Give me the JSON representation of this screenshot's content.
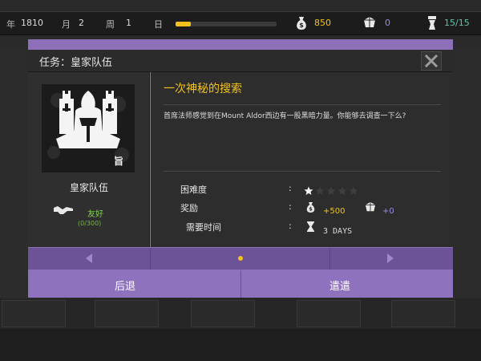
{
  "topbar": {
    "year_label": "年",
    "year_value": "1810",
    "month_label": "月",
    "month_value": "2",
    "week_label": "周",
    "week_value": "1",
    "day_label": "日",
    "day_progress": 0.15,
    "gold_value": "850",
    "gem_value": "0",
    "capacity_value": "15/15",
    "colors": {
      "gold": "#f2c21a",
      "gem": "#9a8ee0",
      "capacity": "#63c3a8"
    }
  },
  "modal": {
    "title": "任务：皇家队伍",
    "team": {
      "name": "皇家队伍",
      "relation": "友好",
      "relation_count": "(0/300)"
    },
    "quest": {
      "title": "一次神秘的搜索",
      "description": "首席法师感觉到在Mount Aldor西边有一股黑暗力量。你能够去调查一下么?",
      "difficulty_label": "困难度",
      "difficulty_stars": 1,
      "difficulty_max": 5,
      "reward_label": "奖励",
      "reward_gold": "+500",
      "reward_gem": "+0",
      "time_label": "需要时间",
      "time_value": "3 DAYS"
    },
    "buttons": {
      "back": "后退",
      "send": "遣遣"
    },
    "colors": {
      "accent": "#8d6fba",
      "title_yellow": "#f2c21a",
      "friendly_green": "#7fcf4a"
    }
  }
}
